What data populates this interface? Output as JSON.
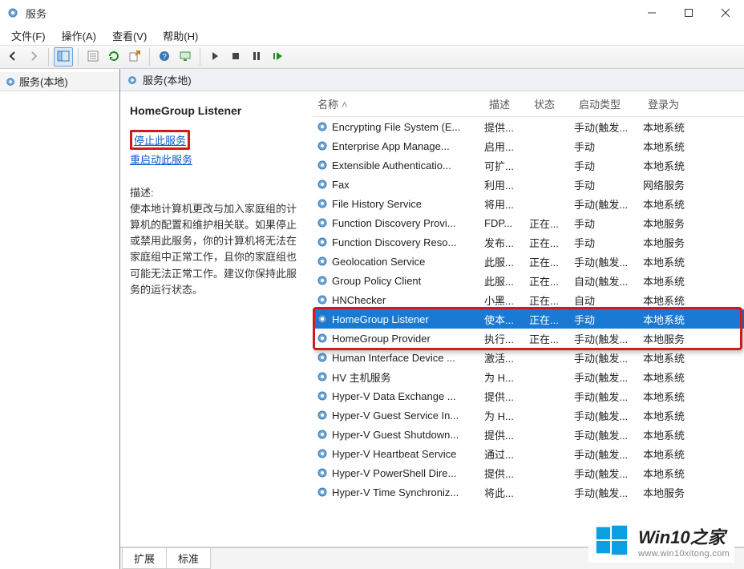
{
  "window": {
    "title": "服务",
    "min_tip": "Minimize",
    "max_tip": "Maximize",
    "close_tip": "Close"
  },
  "menu": {
    "file": "文件(F)",
    "action": "操作(A)",
    "view": "查看(V)",
    "help": "帮助(H)"
  },
  "tree": {
    "root_label": "服务(本地)"
  },
  "right_header": "服务(本地)",
  "detail": {
    "title": "HomeGroup Listener",
    "stop_link": "停止此服务",
    "restart_link": "重启动此服务",
    "desc_label": "描述:",
    "desc_text": "使本地计算机更改与加入家庭组的计算机的配置和维护相关联。如果停止或禁用此服务，你的计算机将无法在家庭组中正常工作，且你的家庭组也可能无法正常工作。建议你保持此服务的运行状态。"
  },
  "columns": {
    "name": "名称",
    "desc": "描述",
    "status": "状态",
    "startup": "启动类型",
    "logon": "登录为"
  },
  "services": [
    {
      "name": "Encrypting File System (E...",
      "desc": "提供...",
      "status": "",
      "startup": "手动(触发...",
      "logon": "本地系统"
    },
    {
      "name": "Enterprise App Manage...",
      "desc": "启用...",
      "status": "",
      "startup": "手动",
      "logon": "本地系统"
    },
    {
      "name": "Extensible Authenticatio...",
      "desc": "可扩...",
      "status": "",
      "startup": "手动",
      "logon": "本地系统"
    },
    {
      "name": "Fax",
      "desc": "利用...",
      "status": "",
      "startup": "手动",
      "logon": "网络服务"
    },
    {
      "name": "File History Service",
      "desc": "将用...",
      "status": "",
      "startup": "手动(触发...",
      "logon": "本地系统"
    },
    {
      "name": "Function Discovery Provi...",
      "desc": "FDP...",
      "status": "正在...",
      "startup": "手动",
      "logon": "本地服务"
    },
    {
      "name": "Function Discovery Reso...",
      "desc": "发布...",
      "status": "正在...",
      "startup": "手动",
      "logon": "本地服务"
    },
    {
      "name": "Geolocation Service",
      "desc": "此服...",
      "status": "正在...",
      "startup": "手动(触发...",
      "logon": "本地系统"
    },
    {
      "name": "Group Policy Client",
      "desc": "此服...",
      "status": "正在...",
      "startup": "自动(触发...",
      "logon": "本地系统"
    },
    {
      "name": "HNChecker",
      "desc": "小黑...",
      "status": "正在...",
      "startup": "自动",
      "logon": "本地系统"
    },
    {
      "name": "HomeGroup Listener",
      "desc": "使本...",
      "status": "正在...",
      "startup": "手动",
      "logon": "本地系统",
      "selected": true,
      "hl": true
    },
    {
      "name": "HomeGroup Provider",
      "desc": "执行...",
      "status": "正在...",
      "startup": "手动(触发...",
      "logon": "本地服务",
      "hl": true
    },
    {
      "name": "Human Interface Device ...",
      "desc": "激活...",
      "status": "",
      "startup": "手动(触发...",
      "logon": "本地系统"
    },
    {
      "name": "HV 主机服务",
      "desc": "为 H...",
      "status": "",
      "startup": "手动(触发...",
      "logon": "本地系统"
    },
    {
      "name": "Hyper-V Data Exchange ...",
      "desc": "提供...",
      "status": "",
      "startup": "手动(触发...",
      "logon": "本地系统"
    },
    {
      "name": "Hyper-V Guest Service In...",
      "desc": "为 H...",
      "status": "",
      "startup": "手动(触发...",
      "logon": "本地系统"
    },
    {
      "name": "Hyper-V Guest Shutdown...",
      "desc": "提供...",
      "status": "",
      "startup": "手动(触发...",
      "logon": "本地系统"
    },
    {
      "name": "Hyper-V Heartbeat Service",
      "desc": "通过...",
      "status": "",
      "startup": "手动(触发...",
      "logon": "本地系统"
    },
    {
      "name": "Hyper-V PowerShell Dire...",
      "desc": "提供...",
      "status": "",
      "startup": "手动(触发...",
      "logon": "本地系统"
    },
    {
      "name": "Hyper-V Time Synchroniz...",
      "desc": "将此...",
      "status": "",
      "startup": "手动(触发...",
      "logon": "本地服务"
    }
  ],
  "tabs": {
    "extended": "扩展",
    "standard": "标准"
  },
  "watermark": {
    "line1": "Win10之家",
    "line2": "www.win10xitong.com"
  }
}
